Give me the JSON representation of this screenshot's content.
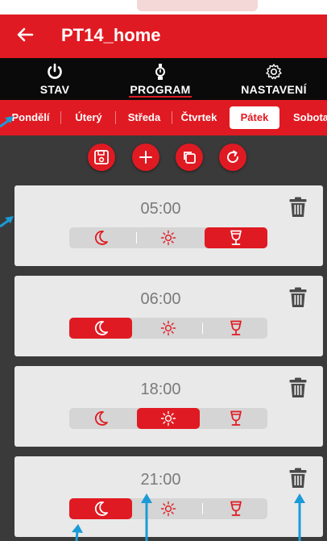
{
  "app": {
    "title": "PT14_home"
  },
  "modes": [
    {
      "label": "STAV",
      "icon": "power-icon"
    },
    {
      "label": "PROGRAM",
      "icon": "program-dial-icon"
    },
    {
      "label": "NASTAVENÍ",
      "icon": "gear-icon"
    }
  ],
  "active_mode": "PROGRAM",
  "days": [
    "Pondělí",
    "Úterý",
    "Středa",
    "Čtvrtek",
    "Pátek",
    "Sobota"
  ],
  "active_day": "Pátek",
  "toolbar": [
    "save-icon",
    "add-icon",
    "copy-icon",
    "refresh-icon"
  ],
  "entries": [
    {
      "time": "05:00",
      "selected": "wine-glass"
    },
    {
      "time": "06:00",
      "selected": "moon"
    },
    {
      "time": "18:00",
      "selected": "sun"
    },
    {
      "time": "21:00",
      "selected": "moon"
    }
  ],
  "mode_icons": [
    "moon-icon",
    "sun-icon",
    "wine-glass-icon"
  ],
  "colors": {
    "accent": "#e01a22",
    "annotation": "#1a9bd7",
    "card": "#e9e9e9"
  }
}
